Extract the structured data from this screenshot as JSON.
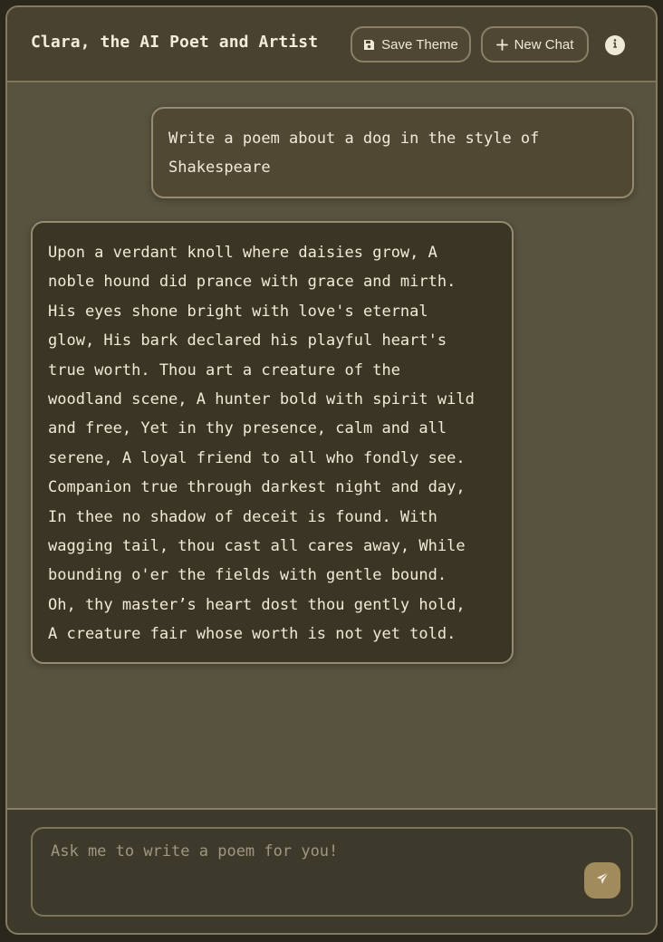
{
  "app": {
    "title": "Clara, the AI Poet and Artist"
  },
  "header": {
    "save_theme_label": "Save Theme",
    "new_chat_label": "New Chat",
    "icons": {
      "save": "floppy-disk-icon",
      "new_chat": "plus-icon",
      "info": "info-icon"
    }
  },
  "messages": [
    {
      "role": "user",
      "text": "Write a poem about a dog in the style of\nShakespeare"
    },
    {
      "role": "assistant",
      "text": "Upon a verdant knoll where daisies grow, A\nnoble hound did prance with grace and mirth.\nHis eyes shone bright with love's eternal\nglow, His bark declared his playful heart's\ntrue worth. Thou art a creature of the\nwoodland scene, A hunter bold with spirit wild\nand free, Yet in thy presence, calm and all\nserene, A loyal friend to all who fondly see.\nCompanion true through darkest night and day,\nIn thee no shadow of deceit is found. With\nwagging tail, thou cast all cares away, While\nbounding o'er the fields with gentle bound.\nOh, thy master’s heart dost thou gently hold,\nA creature fair whose worth is not yet told."
    }
  ],
  "composer": {
    "placeholder": "Ask me to write a poem for you!",
    "value": "",
    "send_icon": "paper-plane-icon"
  },
  "colors": {
    "accent": "#a18a5c",
    "background": "#58533f",
    "header": "#4a4230",
    "assistant_bubble": "#3b3526",
    "user_bubble": "#514834",
    "text": "#f1ead6"
  }
}
